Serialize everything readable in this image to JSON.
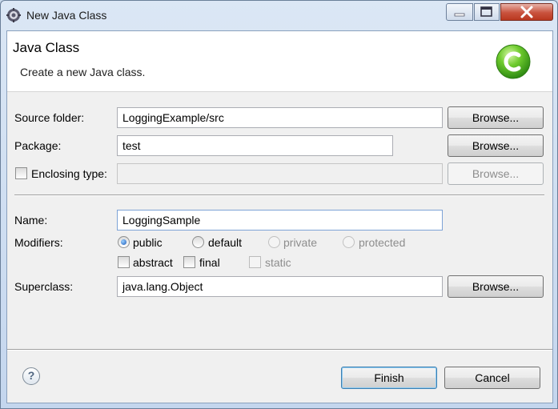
{
  "window": {
    "title": "New Java Class"
  },
  "header": {
    "title": "Java Class",
    "description": "Create a new Java class."
  },
  "form": {
    "source_folder": {
      "label": "Source folder:",
      "value": "LoggingExample/src",
      "browse": "Browse..."
    },
    "package": {
      "label": "Package:",
      "value": "test",
      "browse": "Browse..."
    },
    "enclosing_type": {
      "label": "Enclosing type:",
      "value": "",
      "browse": "Browse...",
      "checked": false
    },
    "name": {
      "label": "Name:",
      "value": "LoggingSample"
    },
    "modifiers": {
      "label": "Modifiers:",
      "public": "public",
      "default": "default",
      "private": "private",
      "protected": "protected",
      "abstract": "abstract",
      "final": "final",
      "static": "static",
      "selected": "public"
    },
    "superclass": {
      "label": "Superclass:",
      "value": "java.lang.Object",
      "browse": "Browse..."
    }
  },
  "footer": {
    "help": "?",
    "finish": "Finish",
    "cancel": "Cancel"
  },
  "colors": {
    "badge_green": "#5cbf2a",
    "accent": "#3c7fb1"
  },
  "icons": {
    "app": "eclipse-gear-icon",
    "badge": "java-class-c-icon",
    "help": "help-icon"
  }
}
